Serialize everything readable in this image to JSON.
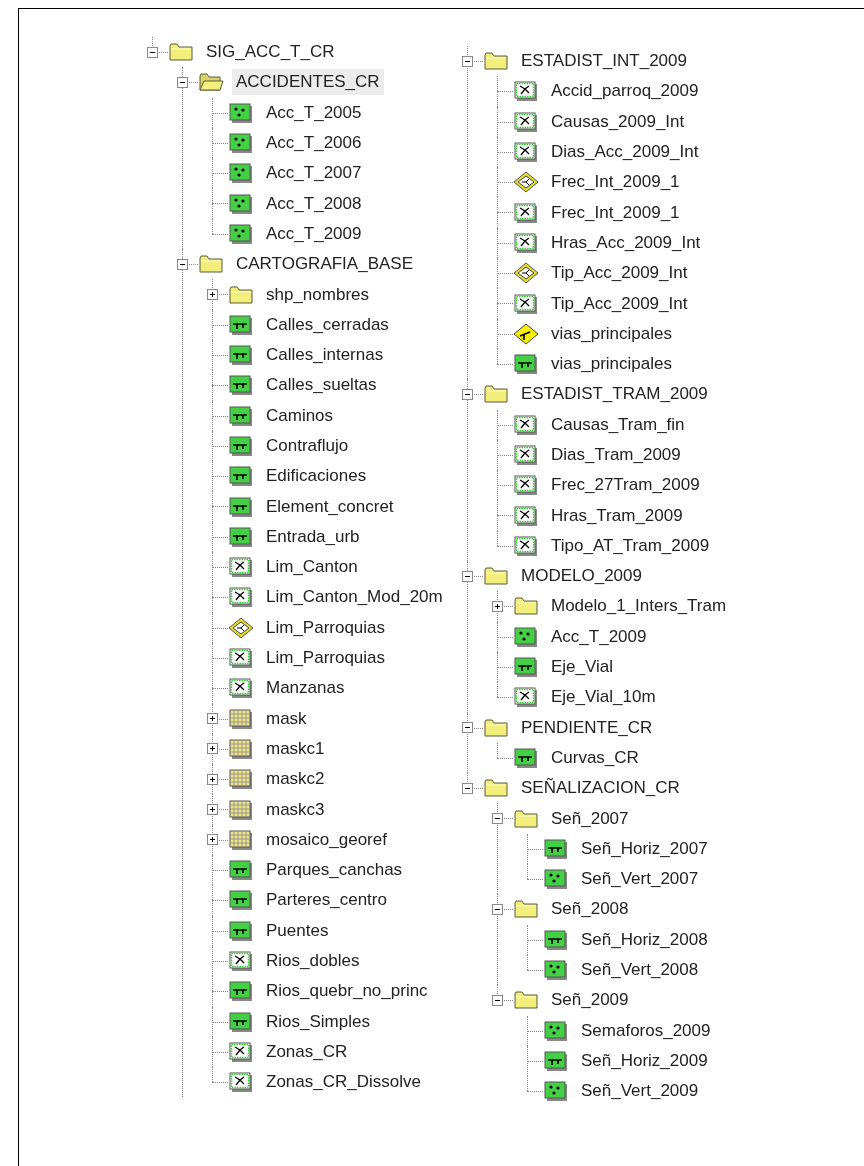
{
  "columns": [
    {
      "nodes": [
        {
          "label": "SIG_ACC_T_CR",
          "kind": "folder",
          "selected": false,
          "expanded": true,
          "children": [
            {
              "label": "ACCIDENTES_CR",
              "kind": "folder",
              "selected": true,
              "expanded": true,
              "children": [
                {
                  "label": "Acc_T_2005",
                  "kind": "point",
                  "selected": false
                },
                {
                  "label": "Acc_T_2006",
                  "kind": "point",
                  "selected": false
                },
                {
                  "label": "Acc_T_2007",
                  "kind": "point",
                  "selected": false
                },
                {
                  "label": "Acc_T_2008",
                  "kind": "point",
                  "selected": false
                },
                {
                  "label": "Acc_T_2009",
                  "kind": "point",
                  "selected": false
                }
              ]
            },
            {
              "label": "CARTOGRAFIA_BASE",
              "kind": "folder",
              "selected": false,
              "expanded": true,
              "children": [
                {
                  "label": "shp_nombres",
                  "kind": "folder",
                  "selected": false,
                  "expanded": false
                },
                {
                  "label": "Calles_cerradas",
                  "kind": "line",
                  "selected": false
                },
                {
                  "label": "Calles_internas",
                  "kind": "line",
                  "selected": false
                },
                {
                  "label": "Calles_sueltas",
                  "kind": "line",
                  "selected": false
                },
                {
                  "label": "Caminos",
                  "kind": "line",
                  "selected": false
                },
                {
                  "label": "Contraflujo",
                  "kind": "line",
                  "selected": false
                },
                {
                  "label": "Edificaciones",
                  "kind": "line",
                  "selected": false
                },
                {
                  "label": "Element_concret",
                  "kind": "line",
                  "selected": false
                },
                {
                  "label": "Entrada_urb",
                  "kind": "line",
                  "selected": false
                },
                {
                  "label": "Lim_Canton",
                  "kind": "polygon",
                  "selected": false
                },
                {
                  "label": "Lim_Canton_Mod_20m",
                  "kind": "polygon",
                  "selected": false
                },
                {
                  "label": "Lim_Parroquias",
                  "kind": "topology",
                  "selected": false
                },
                {
                  "label": "Lim_Parroquias",
                  "kind": "polygon",
                  "selected": false
                },
                {
                  "label": "Manzanas",
                  "kind": "polygon",
                  "selected": false
                },
                {
                  "label": "mask",
                  "kind": "raster",
                  "selected": false,
                  "expanded": false
                },
                {
                  "label": "maskc1",
                  "kind": "raster",
                  "selected": false,
                  "expanded": false
                },
                {
                  "label": "maskc2",
                  "kind": "raster",
                  "selected": false,
                  "expanded": false
                },
                {
                  "label": "maskc3",
                  "kind": "raster",
                  "selected": false,
                  "expanded": false
                },
                {
                  "label": "mosaico_georef",
                  "kind": "raster",
                  "selected": false,
                  "expanded": false
                },
                {
                  "label": "Parques_canchas",
                  "kind": "line",
                  "selected": false
                },
                {
                  "label": "Parteres_centro",
                  "kind": "line",
                  "selected": false
                },
                {
                  "label": "Puentes",
                  "kind": "line",
                  "selected": false
                },
                {
                  "label": "Rios_dobles",
                  "kind": "polygon",
                  "selected": false
                },
                {
                  "label": "Rios_quebr_no_princ",
                  "kind": "line",
                  "selected": false
                },
                {
                  "label": "Rios_Simples",
                  "kind": "line",
                  "selected": false
                },
                {
                  "label": "Zonas_CR",
                  "kind": "polygon",
                  "selected": false
                },
                {
                  "label": "Zonas_CR_Dissolve",
                  "kind": "polygon",
                  "selected": false
                }
              ]
            }
          ]
        }
      ]
    },
    {
      "nodes": [
        {
          "label": "ESTADIST_INT_2009",
          "kind": "folder",
          "selected": false,
          "expanded": true,
          "children": [
            {
              "label": "Accid_parroq_2009",
              "kind": "polygon",
              "selected": false
            },
            {
              "label": "Causas_2009_Int",
              "kind": "polygon",
              "selected": false
            },
            {
              "label": "Dias_Acc_2009_Int",
              "kind": "polygon",
              "selected": false
            },
            {
              "label": "Frec_Int_2009_1",
              "kind": "topology",
              "selected": false
            },
            {
              "label": "Frec_Int_2009_1",
              "kind": "polygon",
              "selected": false
            },
            {
              "label": "Hras_Acc_2009_Int",
              "kind": "polygon",
              "selected": false
            },
            {
              "label": "Tip_Acc_2009_Int",
              "kind": "topology",
              "selected": false
            },
            {
              "label": "Tip_Acc_2009_Int",
              "kind": "polygon",
              "selected": false
            },
            {
              "label": "vias_principales",
              "kind": "network",
              "selected": false
            },
            {
              "label": "vias_principales",
              "kind": "line",
              "selected": false
            }
          ]
        },
        {
          "label": "ESTADIST_TRAM_2009",
          "kind": "folder",
          "selected": false,
          "expanded": true,
          "children": [
            {
              "label": "Causas_Tram_fin",
              "kind": "polygon",
              "selected": false
            },
            {
              "label": "Dias_Tram_2009",
              "kind": "polygon",
              "selected": false
            },
            {
              "label": "Frec_27Tram_2009",
              "kind": "polygon",
              "selected": false
            },
            {
              "label": "Hras_Tram_2009",
              "kind": "polygon",
              "selected": false
            },
            {
              "label": "Tipo_AT_Tram_2009",
              "kind": "polygon",
              "selected": false
            }
          ]
        },
        {
          "label": "MODELO_2009",
          "kind": "folder",
          "selected": false,
          "expanded": true,
          "children": [
            {
              "label": "Modelo_1_Inters_Tram",
              "kind": "folder",
              "selected": false,
              "expanded": false
            },
            {
              "label": "Acc_T_2009",
              "kind": "point",
              "selected": false
            },
            {
              "label": "Eje_Vial",
              "kind": "line",
              "selected": false
            },
            {
              "label": "Eje_Vial_10m",
              "kind": "polygon",
              "selected": false
            }
          ]
        },
        {
          "label": "PENDIENTE_CR",
          "kind": "folder",
          "selected": false,
          "expanded": true,
          "children": [
            {
              "label": "Curvas_CR",
              "kind": "line",
              "selected": false
            }
          ]
        },
        {
          "label": "SEÑALIZACION_CR",
          "kind": "folder",
          "selected": false,
          "expanded": true,
          "children": [
            {
              "label": "Señ_2007",
              "kind": "folder",
              "selected": false,
              "expanded": true,
              "children": [
                {
                  "label": "Señ_Horiz_2007",
                  "kind": "line",
                  "selected": false
                },
                {
                  "label": "Señ_Vert_2007",
                  "kind": "point",
                  "selected": false
                }
              ]
            },
            {
              "label": "Señ_2008",
              "kind": "folder",
              "selected": false,
              "expanded": true,
              "children": [
                {
                  "label": "Señ_Horiz_2008",
                  "kind": "line",
                  "selected": false
                },
                {
                  "label": "Señ_Vert_2008",
                  "kind": "point",
                  "selected": false
                }
              ]
            },
            {
              "label": "Señ_2009",
              "kind": "folder",
              "selected": false,
              "expanded": true,
              "children": [
                {
                  "label": "Semaforos_2009",
                  "kind": "point",
                  "selected": false
                },
                {
                  "label": "Señ_Horiz_2009",
                  "kind": "line",
                  "selected": false
                },
                {
                  "label": "Señ_Vert_2009",
                  "kind": "point",
                  "selected": false
                }
              ]
            }
          ]
        }
      ]
    }
  ]
}
